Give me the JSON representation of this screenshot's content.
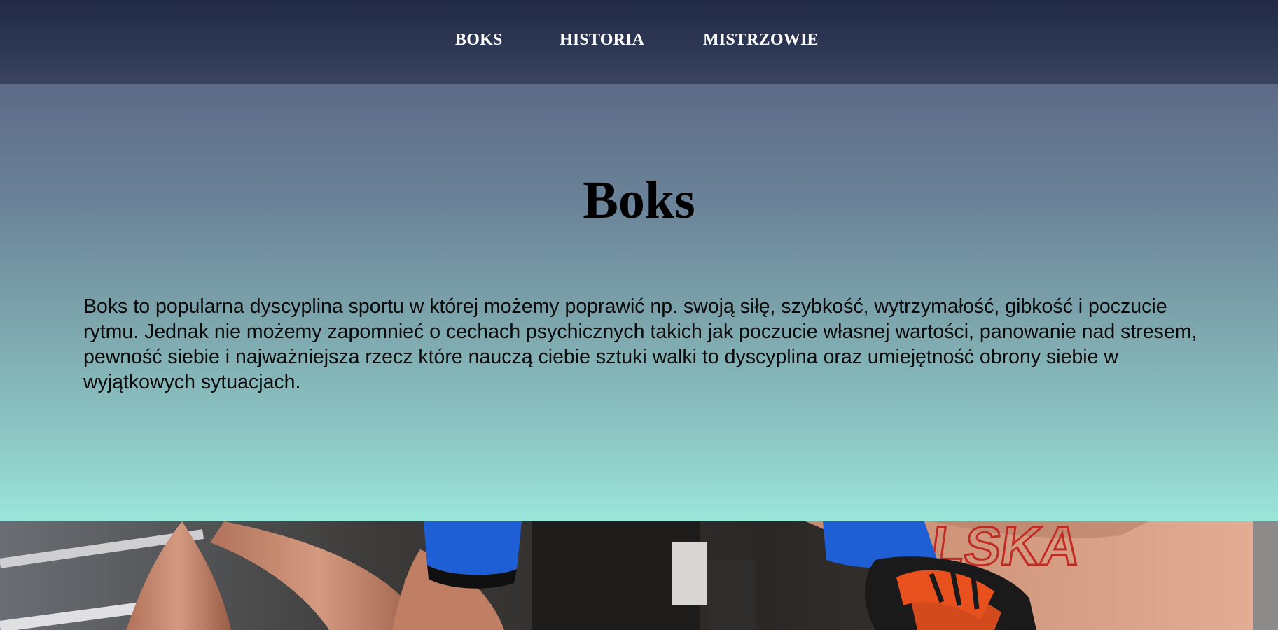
{
  "nav": {
    "items": [
      {
        "label": "BOKS"
      },
      {
        "label": "HISTORIA"
      },
      {
        "label": "MISTRZOWIE"
      }
    ]
  },
  "hero": {
    "title": "Boks",
    "text": "Boks to popularna dyscyplina sportu w której możemy poprawić np. swoją siłę, szybkość, wytrzymałość, gibkość i poczucie rytmu. Jednak nie możemy zapomnieć o cechach psychicznych takich jak poczucie własnej wartości, panowanie nad stresem, pewność siebie i najważniejsza rzecz które nauczą ciebie sztuki walki to dyscyplina oraz umiejętność obrony siebie w wyjątkowych sytuacjach."
  },
  "photo": {
    "shirt_text": "LSKA"
  },
  "colors": {
    "nav_bg": "#2d3753",
    "hero_top": "#5e6a87",
    "hero_bottom": "#9be6da",
    "glove_blue": "#1f5fd6",
    "glove_orange": "#e8511e"
  }
}
